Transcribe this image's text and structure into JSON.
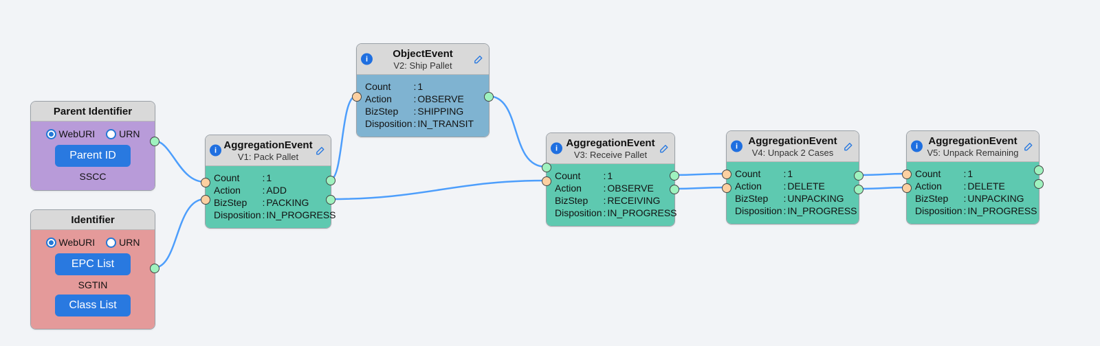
{
  "parent_identifier": {
    "title": "Parent Identifier",
    "radios": {
      "opt1": "WebURI",
      "opt2": "URN"
    },
    "btn1": "Parent ID",
    "type": "SSCC"
  },
  "identifier": {
    "title": "Identifier",
    "radios": {
      "opt1": "WebURI",
      "opt2": "URN"
    },
    "btn1": "EPC List",
    "type": "SGTIN",
    "btn2": "Class List"
  },
  "v1": {
    "title": "AggregationEvent",
    "subtitle": "V1: Pack Pallet",
    "rows": {
      "count_k": "Count",
      "count_v": "1",
      "action_k": "Action",
      "action_v": "ADD",
      "bizstep_k": "BizStep",
      "bizstep_v": "PACKING",
      "disp_k": "Disposition",
      "disp_v": "IN_PROGRESS"
    }
  },
  "v2": {
    "title": "ObjectEvent",
    "subtitle": "V2: Ship Pallet",
    "rows": {
      "count_k": "Count",
      "count_v": "1",
      "action_k": "Action",
      "action_v": "OBSERVE",
      "bizstep_k": "BizStep",
      "bizstep_v": "SHIPPING",
      "disp_k": "Disposition",
      "disp_v": "IN_TRANSIT"
    }
  },
  "v3": {
    "title": "AggregationEvent",
    "subtitle": "V3: Receive Pallet",
    "rows": {
      "count_k": "Count",
      "count_v": "1",
      "action_k": "Action",
      "action_v": "OBSERVE",
      "bizstep_k": "BizStep",
      "bizstep_v": "RECEIVING",
      "disp_k": "Disposition",
      "disp_v": "IN_PROGRESS"
    }
  },
  "v4": {
    "title": "AggregationEvent",
    "subtitle": "V4: Unpack 2 Cases",
    "rows": {
      "count_k": "Count",
      "count_v": "1",
      "action_k": "Action",
      "action_v": "DELETE",
      "bizstep_k": "BizStep",
      "bizstep_v": "UNPACKING",
      "disp_k": "Disposition",
      "disp_v": "IN_PROGRESS"
    }
  },
  "v5": {
    "title": "AggregationEvent",
    "subtitle": "V5: Unpack Remaining",
    "rows": {
      "count_k": "Count",
      "count_v": "1",
      "action_k": "Action",
      "action_v": "DELETE",
      "bizstep_k": "BizStep",
      "bizstep_v": "UNPACKING",
      "disp_k": "Disposition",
      "disp_v": "IN_PROGRESS"
    }
  }
}
